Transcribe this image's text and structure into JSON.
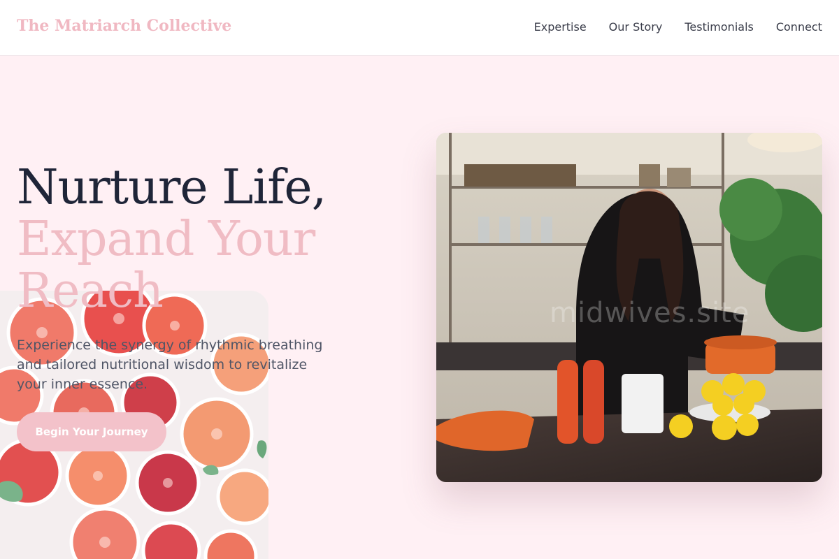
{
  "brand": {
    "name": "The Matriarch Collective"
  },
  "nav": {
    "items": [
      "Expertise",
      "Our Story",
      "Testimonials",
      "Connect"
    ]
  },
  "hero": {
    "headline_line1": "Nurture Life,",
    "headline_line2": "Expand Your Reach",
    "subtext": "Experience the synergy of rhythmic breathing and tailored nutritional wisdom to revitalize your inner essence.",
    "cta_label": "Begin Your Journey",
    "image_watermark": "midwives.site"
  },
  "colors": {
    "page_background": "#fff0f4",
    "brand_pink": "#f0b8c2",
    "headline_dark": "#1f2538",
    "cta_background": "#f3c2ca"
  },
  "icons": [
    "grapefruit-platter-image",
    "kitchen-photo"
  ]
}
